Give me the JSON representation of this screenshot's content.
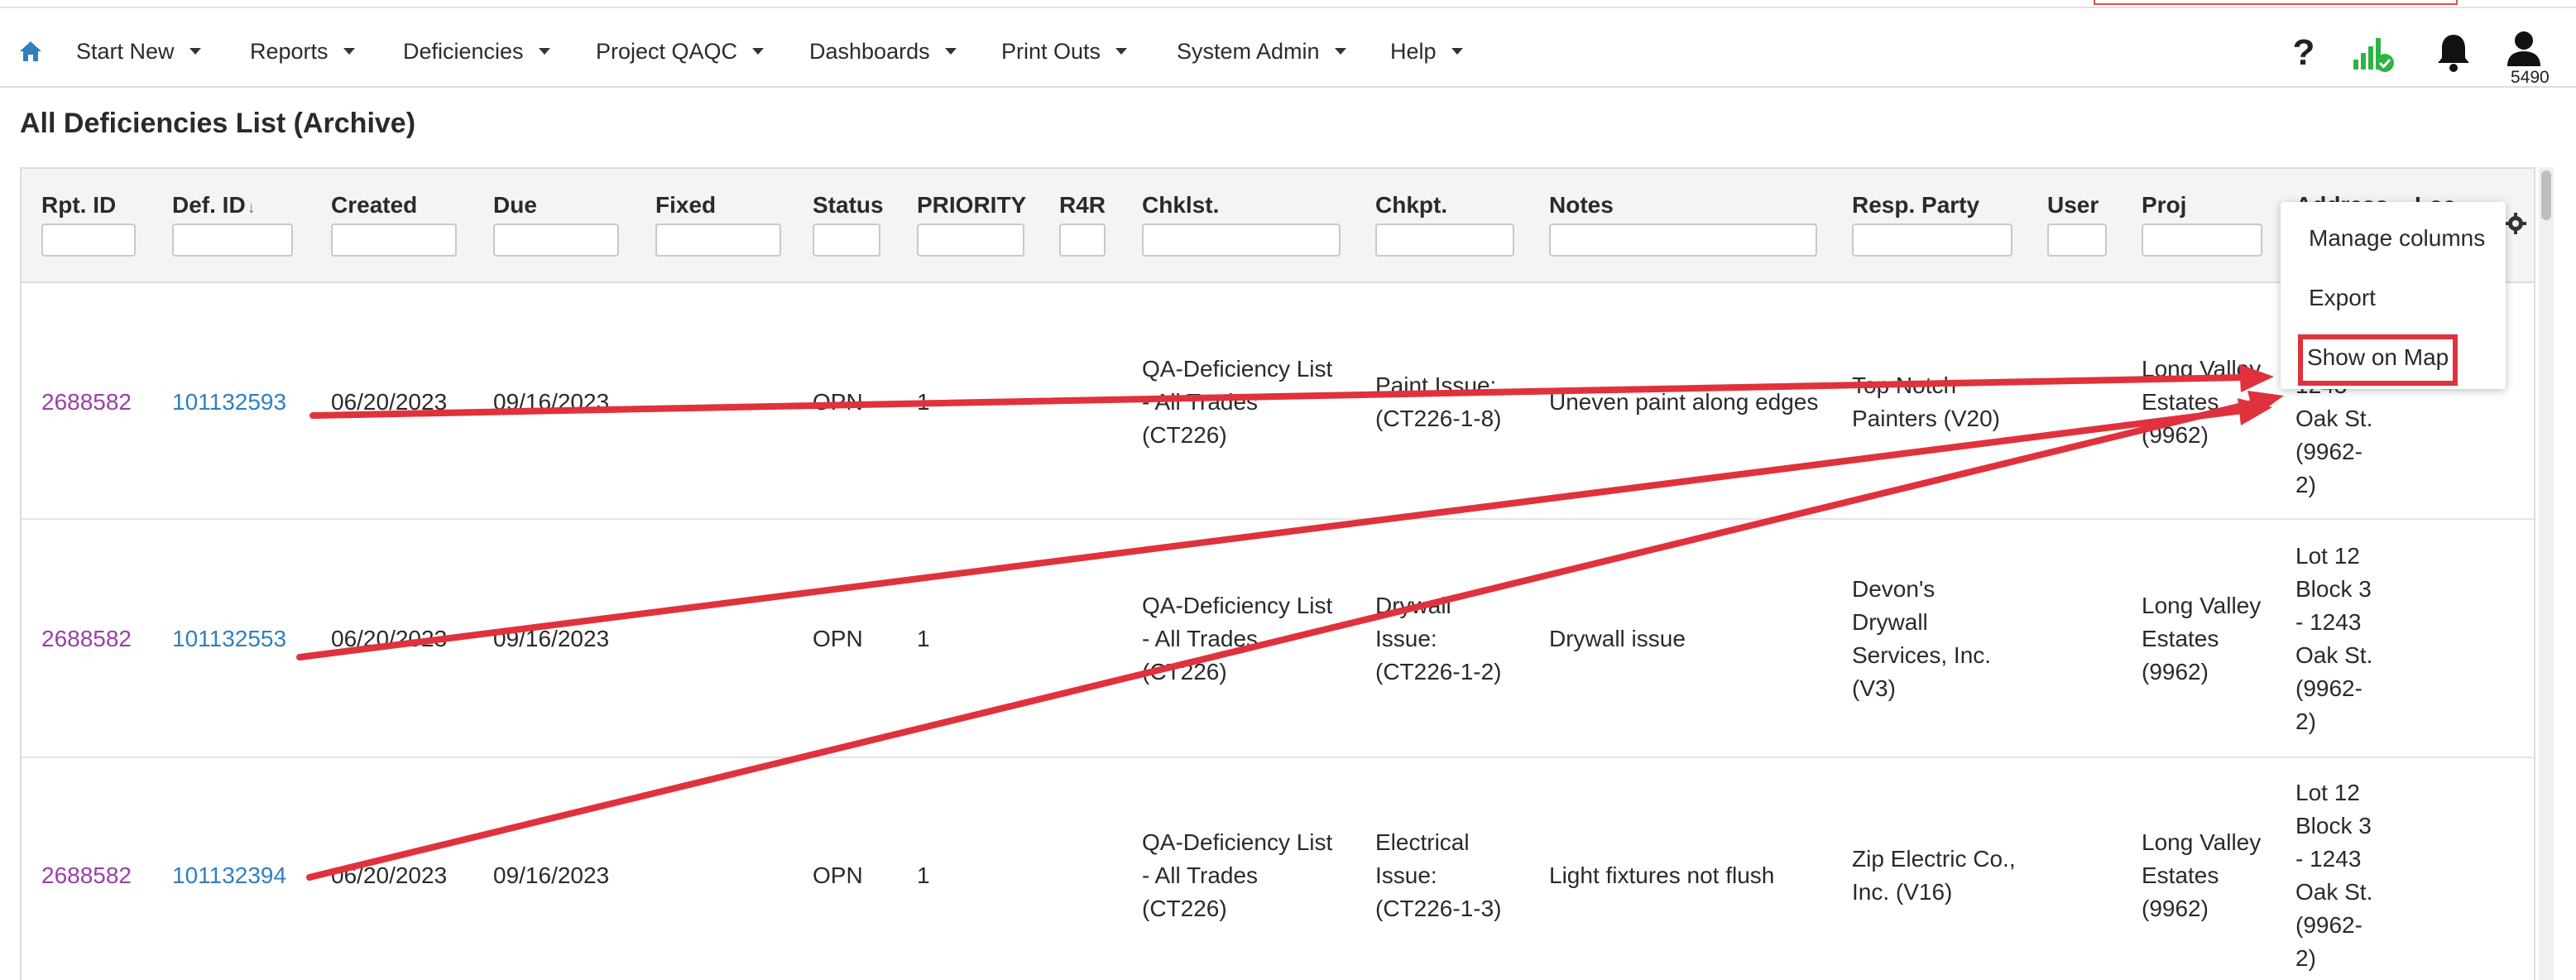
{
  "nav": {
    "items": [
      {
        "label": "Start New"
      },
      {
        "label": "Reports"
      },
      {
        "label": "Deficiencies"
      },
      {
        "label": "Project QAQC"
      },
      {
        "label": "Dashboards"
      },
      {
        "label": "Print Outs"
      },
      {
        "label": "System Admin"
      },
      {
        "label": "Help"
      }
    ],
    "user_count": "5490",
    "icons": [
      "home-icon",
      "help-icon",
      "signal-icon",
      "bell-icon",
      "user-icon"
    ],
    "signal_color": "#2fb344"
  },
  "page": {
    "title": "All Deficiencies List (Archive)"
  },
  "grid": {
    "columns": [
      {
        "label": "Rpt. ID"
      },
      {
        "label": "Def. ID"
      },
      {
        "label": "Created"
      },
      {
        "label": "Due"
      },
      {
        "label": "Fixed"
      },
      {
        "label": "Status"
      },
      {
        "label": "PRIORITY"
      },
      {
        "label": "R4R"
      },
      {
        "label": "Chklst."
      },
      {
        "label": "Chkpt."
      },
      {
        "label": "Notes"
      },
      {
        "label": "Resp. Party"
      },
      {
        "label": "User"
      },
      {
        "label": "Proj"
      },
      {
        "label": "Address"
      },
      {
        "label": "Loc"
      }
    ],
    "rows": [
      {
        "rpt_id": "2688582",
        "def_id": "101132593",
        "created": "06/20/2023",
        "due": "09/16/2023",
        "fixed": "",
        "status": "OPN",
        "priority": "1",
        "r4r": "",
        "chklst": [
          "QA-Deficiency List",
          "- All Trades",
          "(CT226)"
        ],
        "chkpt": [
          "Paint Issue:",
          "(CT226-1-8)"
        ],
        "notes": "Uneven paint along edges",
        "resp_party": [
          "Top Notch",
          "Painters (V20)"
        ],
        "user": "",
        "proj": [
          "Long Valley",
          "Estates",
          "(9962)"
        ],
        "address": [
          "1243",
          "Oak St.",
          "(9962-",
          "2)"
        ]
      },
      {
        "rpt_id": "2688582",
        "def_id": "101132553",
        "created": "06/20/2023",
        "due": "09/16/2023",
        "fixed": "",
        "status": "OPN",
        "priority": "1",
        "r4r": "",
        "chklst": [
          "QA-Deficiency List",
          "- All Trades",
          "(CT226)"
        ],
        "chkpt": [
          "Drywall",
          "Issue:",
          "(CT226-1-2)"
        ],
        "notes": "Drywall issue",
        "resp_party": [
          "Devon's",
          "Drywall",
          "Services, Inc.",
          "(V3)"
        ],
        "user": "",
        "proj": [
          "Long Valley",
          "Estates",
          "(9962)"
        ],
        "address": [
          "Lot 12",
          "Block 3",
          "- 1243",
          "Oak St.",
          "(9962-",
          "2)"
        ]
      },
      {
        "rpt_id": "2688582",
        "def_id": "101132394",
        "created": "06/20/2023",
        "due": "09/16/2023",
        "fixed": "",
        "status": "OPN",
        "priority": "1",
        "r4r": "",
        "chklst": [
          "QA-Deficiency List",
          "- All Trades",
          "(CT226)"
        ],
        "chkpt": [
          "Electrical",
          "Issue:",
          "(CT226-1-3)"
        ],
        "notes": "Light fixtures not flush",
        "resp_party": [
          "Zip Electric Co.,",
          "Inc. (V16)"
        ],
        "user": "",
        "proj": [
          "Long Valley",
          "Estates",
          "(9962)"
        ],
        "address": [
          "Lot 12",
          "Block 3",
          "- 1243",
          "Oak St.",
          "(9962-",
          "2)"
        ]
      }
    ]
  },
  "column_menu": {
    "items": [
      {
        "label": "Manage columns"
      },
      {
        "label": "Export"
      },
      {
        "label": "Show on Map"
      }
    ],
    "highlighted": "Show on Map"
  },
  "colors": {
    "rpt_link": "#9b3fa8",
    "def_link": "#2f7fc1",
    "annotation": "#e0323c"
  }
}
